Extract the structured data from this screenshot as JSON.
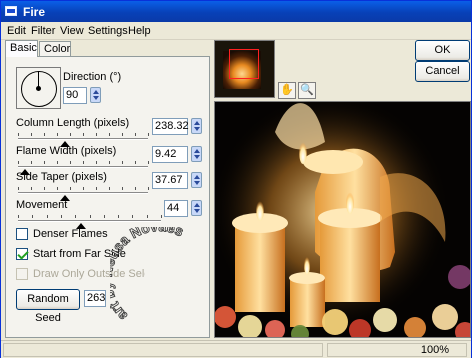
{
  "window": {
    "title": "Fire"
  },
  "menu": [
    "Edit",
    "Filter",
    "View",
    "Settings",
    "Help"
  ],
  "tabs": [
    {
      "label": "Basic",
      "active": true
    },
    {
      "label": "Color",
      "active": false
    }
  ],
  "direction": {
    "label": "Direction (°)",
    "value": "90"
  },
  "sliders": [
    {
      "label": "Column Length (pixels)",
      "value": "238.32",
      "fraction": 0.36
    },
    {
      "label": "Flame Width (pixels)",
      "value": "9.42",
      "fraction": 0.05
    },
    {
      "label": "Side Taper (pixels)",
      "value": "37.67",
      "fraction": 0.36
    },
    {
      "label": "Movement",
      "value": "44",
      "fraction": 0.44
    }
  ],
  "checkboxes": [
    {
      "label": "Denser Flames",
      "checked": false,
      "enabled": true
    },
    {
      "label": "Start from Far Side",
      "checked": true,
      "enabled": true
    },
    {
      "label": "Draw Only Outside Selection",
      "checked": false,
      "enabled": false
    }
  ],
  "random_seed": {
    "label": "Random Seed",
    "value": "263"
  },
  "buttons": {
    "ok": "OK",
    "cancel": "Cancel"
  },
  "watermark": "art by Neusa Novaes",
  "status": {
    "zoom": "100%"
  }
}
